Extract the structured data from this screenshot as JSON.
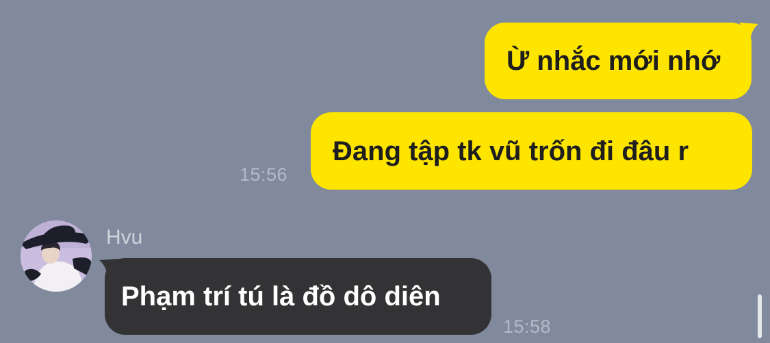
{
  "chat": {
    "messages": [
      {
        "direction": "outgoing",
        "text": "Ừ nhắc mới nhớ"
      },
      {
        "direction": "outgoing",
        "text": "Đang tập tk vũ trốn đi đâu r",
        "time": "15:56"
      },
      {
        "direction": "incoming",
        "sender": "Hvu",
        "text": "Phạm trí tú là đồ dô diên",
        "time": "15:58"
      }
    ]
  },
  "colors": {
    "background": "#808a9c",
    "outgoing_bubble": "#fee500",
    "incoming_bubble": "#333335",
    "timestamp": "#b4bac6"
  },
  "icons": {
    "avatar": "avatar-photo"
  }
}
